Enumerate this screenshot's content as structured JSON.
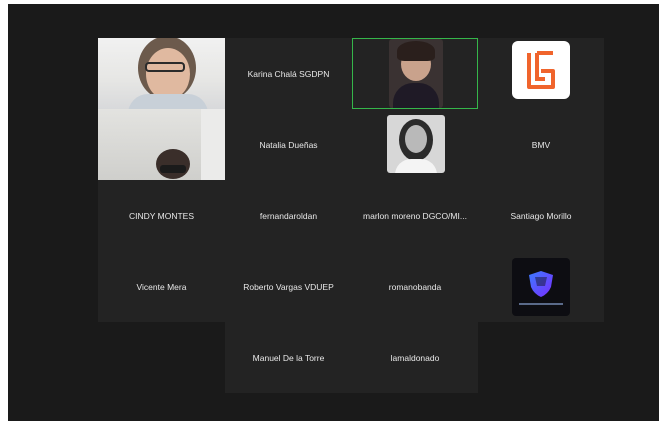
{
  "participants": [
    {
      "name": "",
      "video": true
    },
    {
      "name": "Karina Chalá SGDPN"
    },
    {
      "name": "",
      "video": true,
      "speaking": true
    },
    {
      "name": "",
      "logo": "orange-g-logo"
    },
    {
      "name": "",
      "video": true
    },
    {
      "name": "Natalia Dueñas"
    },
    {
      "name": "",
      "photo": true
    },
    {
      "name": "BMV"
    },
    {
      "name": "CINDY MONTES"
    },
    {
      "name": "fernandaroldan"
    },
    {
      "name": "marlon moreno DGCO/MI..."
    },
    {
      "name": "Santiago Morillo"
    },
    {
      "name": "Vicente Mera"
    },
    {
      "name": "Roberto Vargas VDUEP"
    },
    {
      "name": "romanobanda"
    },
    {
      "name": "",
      "logo": "shield-logo"
    },
    {
      "name": "Manuel De la Torre"
    },
    {
      "name": "lamaldonado"
    }
  ],
  "colors": {
    "background": "#1a1a1a",
    "tile": "#232323",
    "active_speaker_border": "#35b64a",
    "brand_orange": "#f0642c"
  }
}
